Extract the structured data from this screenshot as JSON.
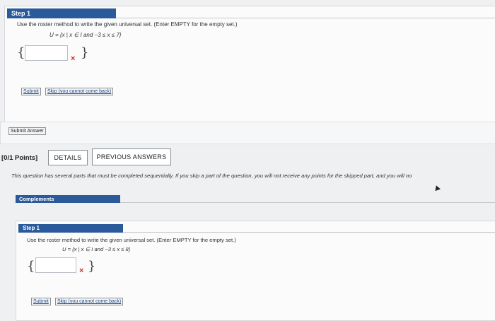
{
  "step1_top": {
    "step_label": "Step 1",
    "instruction": "Use the roster method to write the given universal set. (Enter EMPTY for the empty set.)",
    "set_definition": "U = {x | x ∈ I and −3 ≤ x ≤ 7}",
    "brace_open": "{",
    "brace_close": "}",
    "answer_value": "",
    "x_mark": "×",
    "submit_label": "Submit",
    "skip_label": "Skip (you cannot come back)"
  },
  "submit_answer_label": "Submit Answer",
  "question_header": {
    "points": "[0/1 Points]",
    "details_label": "DETAILS",
    "previous_answers_label": "PREVIOUS ANSWERS"
  },
  "notice": "This question has several parts that must be completed sequentially. If you skip a part of the question, you will not receive any points for the skipped part, and you will no",
  "complements_label": "Complements",
  "step1_bottom": {
    "step_label": "Step 1",
    "instruction": "Use the roster method to write the given universal set. (Enter EMPTY for the empty set.)",
    "set_definition": "U = {x | x ∈ I and −3 ≤ x ≤ 8}",
    "brace_open": "{",
    "brace_close": "}",
    "answer_value": "",
    "x_mark": "×",
    "submit_label": "Submit",
    "skip_label": "Skip (you cannot come back)"
  }
}
